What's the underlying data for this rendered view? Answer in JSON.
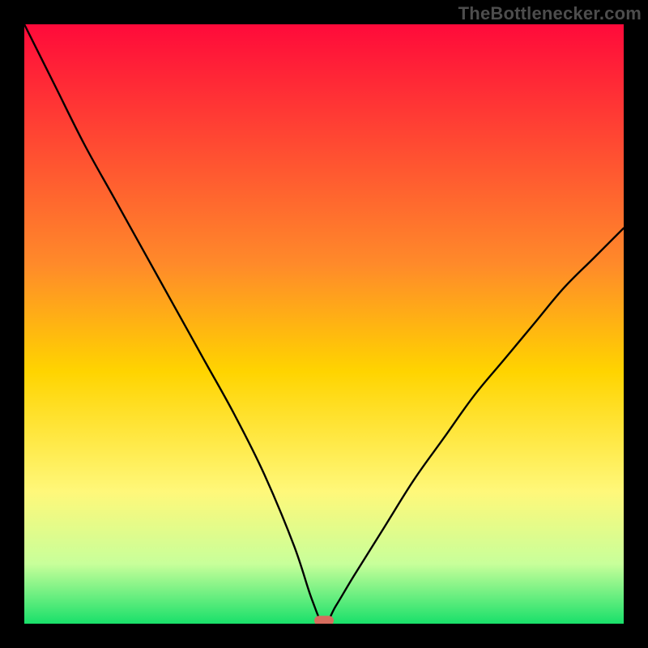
{
  "watermark": "TheBottlenecker.com",
  "chart_data": {
    "type": "line",
    "title": "",
    "xlabel": "",
    "ylabel": "",
    "xlim": [
      0,
      100
    ],
    "ylim": [
      0,
      100
    ],
    "x": [
      0,
      5,
      10,
      15,
      20,
      25,
      30,
      35,
      40,
      45,
      48,
      50,
      52,
      55,
      60,
      65,
      70,
      75,
      80,
      85,
      90,
      95,
      100
    ],
    "values": [
      100,
      90,
      80,
      71,
      62,
      53,
      44,
      35,
      25,
      13,
      4,
      0,
      3,
      8,
      16,
      24,
      31,
      38,
      44,
      50,
      56,
      61,
      66
    ],
    "gradient_stops": [
      {
        "offset": 0,
        "color": "#ff0a3a"
      },
      {
        "offset": 40,
        "color": "#ff8a2a"
      },
      {
        "offset": 58,
        "color": "#ffd400"
      },
      {
        "offset": 78,
        "color": "#fff87a"
      },
      {
        "offset": 90,
        "color": "#c8ff9a"
      },
      {
        "offset": 100,
        "color": "#19e06a"
      }
    ],
    "marker": {
      "x_pct": 50,
      "y_pct": 0.5,
      "color": "#d76d5e"
    }
  }
}
